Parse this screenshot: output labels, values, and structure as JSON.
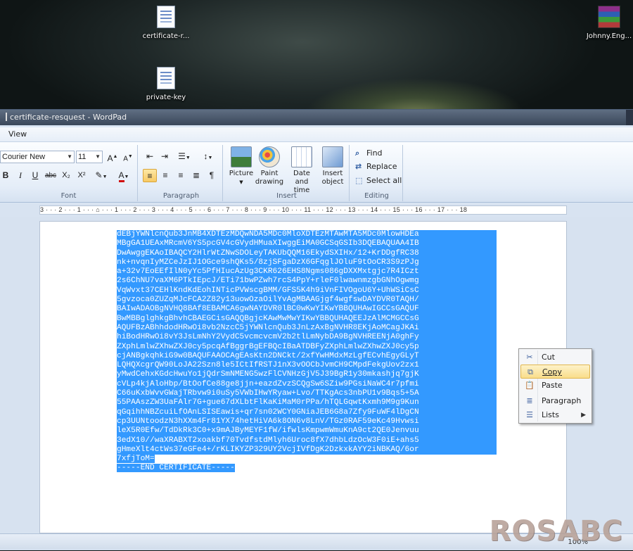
{
  "desktop": {
    "icons": [
      {
        "label": "certificate-r..."
      },
      {
        "label": "private-key"
      },
      {
        "label": "Johnny.Eng..."
      }
    ]
  },
  "window": {
    "title": "certificate-resquest - WordPad",
    "menu": {
      "view": "View"
    }
  },
  "ribbon": {
    "font": {
      "family": "Courier New",
      "size": "11",
      "grow": "A",
      "shrink": "A",
      "bold": "B",
      "italic": "I",
      "underline": "U",
      "strike": "abc",
      "subscript": "X₂",
      "superscript": "X²",
      "label": "Font"
    },
    "paragraph": {
      "label": "Paragraph"
    },
    "insert": {
      "picture": "Picture",
      "paint": "Paint drawing",
      "datetime": "Date and time",
      "object": "Insert object",
      "label": "Insert"
    },
    "editing": {
      "find": "Find",
      "replace": "Replace",
      "select_all": "Select all",
      "label": "Editing"
    }
  },
  "ruler": {
    "text": "3 · · · 2 · · · 1 · · · ⌂ · · · 1 · · · 2 · · · 3 · · · 4 · · · 5 · · · 6 · · · 7 · · · 8 · · · 9 · · · 10 · · · 11 · · · 12 · · · 13 · · · 14 · · · 15 · · · 16 · · · 17 · · · 18"
  },
  "document": {
    "lines": [
      "dEBjYWNlcnQub3JnMB4XDTEzMDQwNDA5MDc0MloXDTEzMTAwMTA5MDc0MlowHDEa",
      "MBgGA1UEAxMRcmV6YS5pcGV4cGVydHMuaXIwggEiMA0GCSqGSIb3DQEBAQUAA4IB",
      "DwAwggEKAoIBAQCY2HlrWtZNwSDOLeyTAKUbQQM16EkydSXIHx/12+KrDDgfRC38",
      "nk+nvqnIyMZCeJzIJ1OGce9shQKs5/8zjSFgaDzX6GFqglJOluF9tOoCR3S9zPJg",
      "a+32v7EoEEfIlN0yYc5PfHIucAzUg3CKR626EHS8Ngms086gDXXMxtgjc7R4ICzt",
      "2s6ChNU7vaXM6PTkIEpcJ/ETi71bwPZwh7rcS4PpY+rleF0lwawnmzgbGNhOgwmg",
      "VqWvxt37CEHlKndKdEohINTicPVWscgBMM/GFS5K4h9iVnFIVOgoU6Y+UhWSiCsC",
      "5gvzoca0ZUZqMJcFCA2Z82y13uowOzaOilYvAgMBAAGjgf4wgfswDAYDVR0TAQH/",
      "BAIwADAOBgNVHQ8BAf8EBAMCA6gwNAYDVR0lBC0wKwYIKwYBBQUHAwIGCCsGAQUF",
      "BwMBBglghkgBhvhCBAEGCisGAQQBgjcKAwMwMwYIKwYBBQUHAQEEJzAlMCMGCCsG",
      "AQUFBzABhhdodHRwOi8vb2NzcC5jYWNlcnQub3JnLzAxBgNVHR8EKjAoMCagJKAi",
      "hiBodHRwOi8vY3JsLmNhY2VydC5vcmcvcmV2b2tlLmNybDA9BgNVHREENjA0ghFy",
      "ZXphLmlwZXhwZXJ0cy5pcqAfBggrBgEFBQcIBaATDBFyZXphLmlwZXhwZXJ0cy5p",
      "cjANBgkqhkiG9w0BAQUFAAOCAgEAsKtn2DNCkt/2xfYwHMdxMzLgfECvhEgyGLyT",
      "LQHQXcgrQW90LoJA22Szn8le5ICtIfRSTJ1nX3vOOCbJvmCH9CMpdFekgUov2zx1",
      "yMwdCehxKGdcHwuYo1jQdrSmNMENG5wzFlCVNHzGjV5J39BgR1y30mkashjq7gjK",
      "cVLp4kjAloHbp/BtOofCe88ge8jjn+eazdZvzSCQgSw6SZiw9PGsiNaWC4r7pfmi",
      "C66uKxbWvvGWajTRbvw9i0uSy5VWbIHwYRyaw+Lvo/TTKgAcs3nbPU1v9Bqs5+5A",
      "55PAAszZW3UaFAlr7G+gue67dXLbtFlKaKiMaM0rPPa/hTQLGqwtKxmh9M9g9Kun",
      "qGqihhNBZcuiLfOAnLSISEawis+qr7sn02WCY0GNiaJEB6G8a7Zfy9FuWF4lDgCN",
      "cp3UUNtoodzN3hXXm4Fr81YX74hetHiVA6k8ON6v8LnV/TGz0RAF59eKc49Hvwsi",
      "leX5R0Efw/TdDkRk3C0+x9mAJByMEYF1fW/ifwlsKmpwmWmuKnA9ct2QE0Jenvuu",
      "3edX10//waXRABXT2xoakbf70TvdfstdMlyh6Uroc8fX7dhbLdzOcW3F0iE+ahs5",
      "gHmeXlt4ctWs37eGFe4+/rKLIKYZP329UY2VcjIVfDgK2DzkxkAYY2iNBKAQ/6or",
      "7xfjToM=",
      "-----END CERTIFICATE-----"
    ]
  },
  "context_menu": {
    "items": [
      {
        "label": "Cut",
        "icon": "scissors-icon"
      },
      {
        "label": "Copy",
        "icon": "copy-icon"
      },
      {
        "label": "Paste",
        "icon": "paste-icon"
      },
      {
        "label": "Paragraph",
        "icon": "paragraph-icon"
      },
      {
        "label": "Lists",
        "icon": "list-icon"
      }
    ]
  },
  "status": {
    "zoom": "100%",
    "watermark": "ROSABC"
  }
}
